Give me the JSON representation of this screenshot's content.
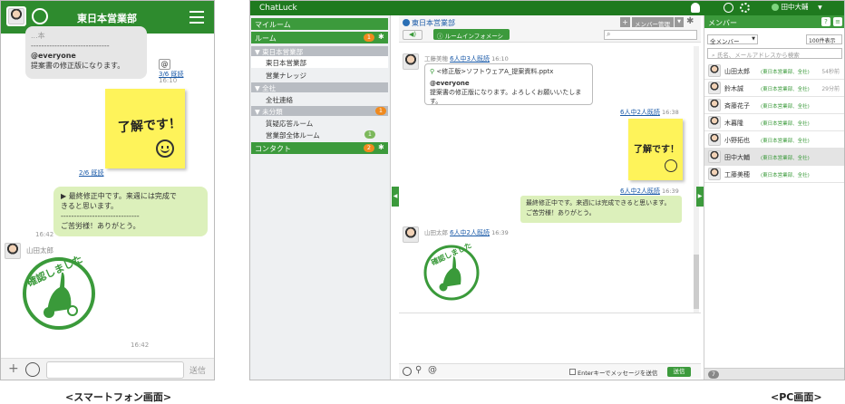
{
  "phone": {
    "title": "東日本営業部",
    "msg1_cut": "...本",
    "msg1_dash": "------------------------------",
    "msg1_everyone": "@everyone",
    "msg1_body": "提案書の修正版になります。",
    "msg1_at": "@",
    "msg1_read": "3/6 既読",
    "msg1_time": "16:10",
    "sticker1_text": "了解です！",
    "sticker1_read": "2/6 既読",
    "msg2_line1": "▶ 最終修正中です。来週には完成で",
    "msg2_line2": "きると思います。",
    "msg2_dash": "------------------------------",
    "msg2_line3": "ご苦労様！ありがとう。",
    "msg2_time": "16:42",
    "sender": "山田太郎",
    "stamp_text": "確認しました",
    "stamp_time": "16:42",
    "input_send": "送信",
    "caption": "<スマートフォン画面>"
  },
  "pc": {
    "app_name": "ChatLuck",
    "header_user": "田中大輔",
    "left": {
      "myroom": "マイルーム",
      "room": "ルーム",
      "room_badge": "1",
      "group1": "東日本営業部",
      "group1_items": [
        "東日本営業部",
        "営業ナレッジ"
      ],
      "group2": "全社",
      "group2_items": [
        "全社連絡"
      ],
      "group3": "未分類",
      "group3_badge": "1",
      "group3_items": [
        "質疑応答ルーム",
        "営業部全体ルーム"
      ],
      "group3_item2_badge": "1",
      "contact": "コンタクト",
      "contact_badge": "2"
    },
    "center": {
      "room_title": "東日本営業部",
      "member_mgmt": "メンバー管理",
      "room_info": "ルームインフォメーション",
      "msg1_sender": "工藤美穂",
      "msg1_read": "6人中3人既読",
      "msg1_time": "16:10",
      "msg1_file": "<修正版>ソフトウェアA_提案資料.pptx",
      "msg1_everyone": "@everyone",
      "msg1_body": "提案書の修正版になります。よろしくお願いいたします。",
      "sticker_read": "6人中2人既読",
      "sticker_time": "16:38",
      "sticker_text": "了解です！",
      "msg2_read": "6人中2人既読",
      "msg2_time": "16:39",
      "msg2_line1": "最終修正中です。来週には完成できると思います。",
      "msg2_line2": "ご苦労様！ありがとう。",
      "msg3_sender": "山田太郎",
      "msg3_read": "6人中2人既読",
      "msg3_time": "16:39",
      "stamp_text": "確認しました",
      "enter_label": "Enterキーでメッセージを送信",
      "send_label": "送信"
    },
    "right": {
      "title": "メンバー",
      "filter_select": "全メンバー",
      "page_select": "100件表示",
      "search_placeholder": "氏名、メールアドレスから検索",
      "members": [
        {
          "name": "山田太郎",
          "dept": "(東日本営業部、全社)",
          "status": "54秒前"
        },
        {
          "name": "鈴木誠",
          "dept": "(東日本営業部、全社)",
          "status": "29分前"
        },
        {
          "name": "斉藤花子",
          "dept": "(東日本営業部、全社)",
          "status": ""
        },
        {
          "name": "木暮隆",
          "dept": "(東日本営業部、全社)",
          "status": ""
        },
        {
          "name": "小野拓也",
          "dept": "(東日本営業部、全社)",
          "status": ""
        },
        {
          "name": "田中大輔",
          "dept": "(東日本営業部、全社)",
          "status": ""
        },
        {
          "name": "工藤美穂",
          "dept": "(東日本営業部、全社)",
          "status": ""
        }
      ],
      "count": "7"
    },
    "caption": "<PC画面>"
  }
}
